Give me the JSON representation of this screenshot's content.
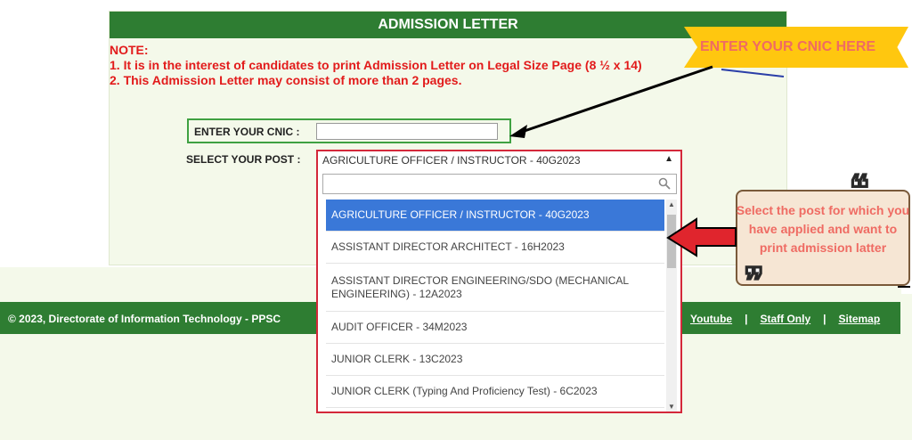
{
  "page": {
    "title": "ADMISSION LETTER",
    "note_heading": "NOTE:",
    "note_lines": [
      "1. It is in the interest of candidates to print Admission Letter on Legal Size Page (8 ½ x 14)",
      "2. This Admission Letter may consist of more than 2 pages."
    ]
  },
  "form": {
    "cnic_label": "ENTER YOUR CNIC :",
    "cnic_value": "",
    "post_label": "SELECT YOUR POST :",
    "selected_post": "AGRICULTURE OFFICER / INSTRUCTOR - 40G2023",
    "search_value": ""
  },
  "dropdown_options": [
    "AGRICULTURE OFFICER / INSTRUCTOR - 40G2023",
    "ASSISTANT DIRECTOR ARCHITECT - 16H2023",
    "ASSISTANT DIRECTOR ENGINEERING/SDO (MECHANICAL ENGINEERING) - 12A2023",
    "AUDIT OFFICER - 34M2023",
    "JUNIOR CLERK - 13C2023",
    "JUNIOR CLERK (Typing And Proficiency Test) - 6C2023"
  ],
  "footer": {
    "copyright": "© 2023, Directorate of Information Technology - PPSC",
    "links": [
      "Youtube",
      "Staff Only",
      "Sitemap"
    ],
    "separator": "|"
  },
  "annotations": {
    "banner": "ENTER YOUR CNIC HERE",
    "callout": "Select the post for which you have applied and want to print admission latter"
  },
  "colors": {
    "brand_green": "#2e7d32",
    "note_red": "#e21b1b",
    "highlight_blue": "#3a78d8",
    "annotation_red": "#d4283a",
    "banner_yellow": "#ffc70f"
  },
  "icons": {
    "search": "search-icon",
    "caret": "caret-up-icon"
  }
}
